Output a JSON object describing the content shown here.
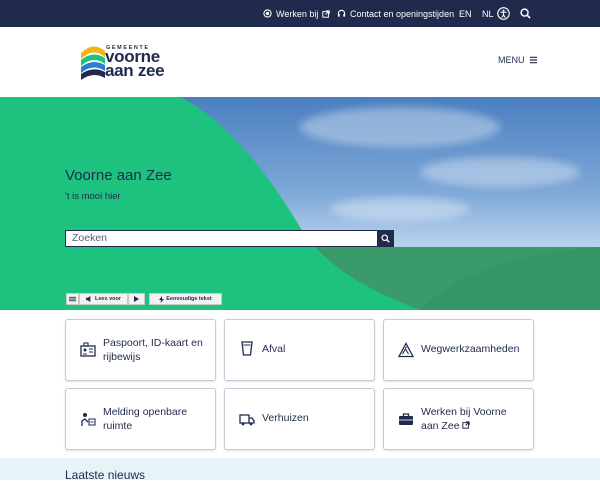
{
  "topbar": {
    "werken_bij": "Werken bij",
    "contact": "Contact en openingstijden",
    "lang_en": "EN",
    "lang_nl": "NL"
  },
  "header": {
    "logo_small": "GEMEENTE",
    "logo_line1": "voorne",
    "logo_line2": "aan zee",
    "menu_label": "MENU"
  },
  "hero": {
    "title": "Voorne aan Zee",
    "subtitle": "'t is mooi hier",
    "search_placeholder": "Zoeken",
    "readspeaker_label": "Lees voor",
    "simple_text_label": "Eenvoudige tekst"
  },
  "cards": [
    {
      "label": "Paspoort, ID-kaart en rijbewijs",
      "icon": "id-card-icon"
    },
    {
      "label": "Afval",
      "icon": "trash-bin-icon"
    },
    {
      "label": "Wegwerkzaamheden",
      "icon": "road-warning-icon"
    },
    {
      "label": "Melding openbare ruimte",
      "icon": "report-icon"
    },
    {
      "label": "Verhuizen",
      "icon": "moving-truck-icon"
    },
    {
      "label": "Werken bij Voorne aan Zee",
      "icon": "briefcase-icon"
    }
  ],
  "news": {
    "heading": "Laatste nieuws"
  },
  "colors": {
    "navy": "#1f2a4d",
    "green": "#1ec27f",
    "news_bg": "#e6f4f7"
  }
}
